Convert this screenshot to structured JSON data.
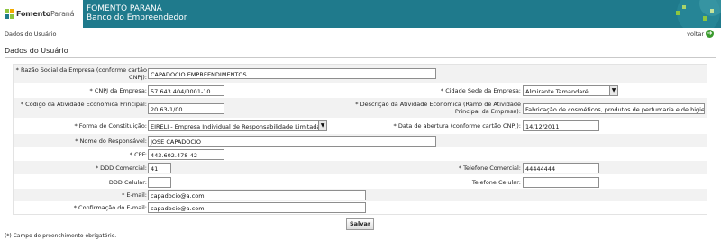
{
  "header": {
    "logo_bold": "Fomento",
    "logo_light": "Paraná",
    "brand_line1": "FOMENTO PARANÁ",
    "brand_line2": "Banco do Empreendedor"
  },
  "subbar": {
    "breadcrumb": "Dados do Usuário",
    "back_label": "voltar",
    "back_icon": "arrow-right-icon"
  },
  "section": {
    "title": "Dados do Usuário"
  },
  "form": {
    "razao_social": {
      "label": "* Razão Social da Empresa (conforme cartão CNPJ):",
      "value": "CAPADOCIO EMPREENDIMENTOS"
    },
    "cnpj": {
      "label": "* CNPJ da Empresa:",
      "value": "57.643.404/0001-10"
    },
    "cidade": {
      "label": "* Cidade Sede da Empresa:",
      "value": "Almirante Tamandaré"
    },
    "cod_atividade": {
      "label": "* Código da Atividade Econômica Principal:",
      "value": "20.63-1/00"
    },
    "desc_atividade": {
      "label": "* Descrição da Atividade Econômica (Ramo de Atividade Principal da Empresa):",
      "value": "Fabricação de cosméticos, produtos de perfumaria e de higiene p"
    },
    "forma_constituicao": {
      "label": "* Forma de Constituição:",
      "value": "EIRELI - Empresa Individual de Responsabilidade Limitada"
    },
    "data_abertura": {
      "label": "* Data de abertura (conforme cartão CNPJ):",
      "value": "14/12/2011"
    },
    "responsavel": {
      "label": "* Nome do Responsável:",
      "value": "JOSE CAPADOCIO"
    },
    "cpf": {
      "label": "* CPF:",
      "value": "443.602.478-42"
    },
    "ddd_comercial": {
      "label": "* DDD Comercial:",
      "value": "41"
    },
    "tel_comercial": {
      "label": "* Telefone Comercial:",
      "value": "44444444"
    },
    "ddd_celular": {
      "label": "DDD Celular:",
      "value": ""
    },
    "tel_celular": {
      "label": "Telefone Celular:",
      "value": ""
    },
    "email": {
      "label": "* E-mail:",
      "value": "capadocio@a.com"
    },
    "confirm_email": {
      "label": "* Confirmação do E-mail:",
      "value": "capadocio@a.com"
    }
  },
  "save_label": "Salvar",
  "footnote": "(*) Campo de preenchimento obrigatório.",
  "colors": {
    "header_bg": "#1f7a8c",
    "logo_green": "#8dc63f",
    "logo_teal": "#1f7a8c",
    "back_icon_green": "#3b9b2e"
  }
}
